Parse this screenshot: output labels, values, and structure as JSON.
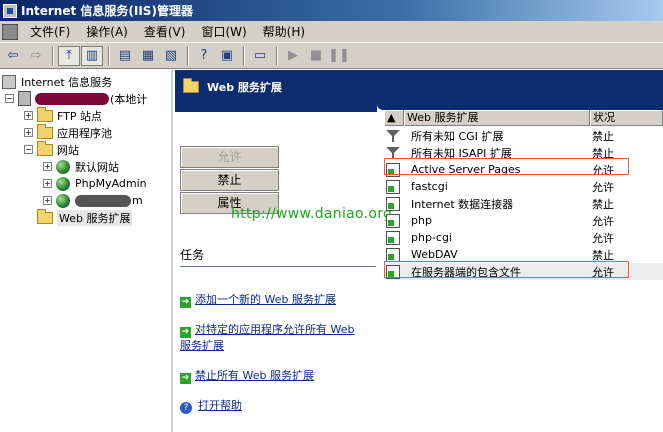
{
  "window": {
    "title": "Internet 信息服务(IIS)管理器"
  },
  "menu": [
    "文件(F)",
    "操作(A)",
    "查看(V)",
    "窗口(W)",
    "帮助(H)"
  ],
  "tree": {
    "root": "Internet 信息服务",
    "server_suffix": "(本地计",
    "items": {
      "ftp": "FTP 站点",
      "apppool": "应用程序池",
      "websites": "网站",
      "default_site": "默认网站",
      "phpmyadmin": "PhpMyAdmin",
      "third_site_suffix": "m",
      "web_ext": "Web 服务扩展"
    }
  },
  "pane": {
    "header": "Web 服务扩展",
    "buttons": {
      "allow": "允许",
      "deny": "禁止",
      "properties": "属性"
    },
    "tasks_title": "任务",
    "tasks": {
      "add_new": "添加一个新的 Web 服务扩展",
      "allow_all_line1": "对特定的应用程序允许所有 Web",
      "allow_all_line2": "服务扩展",
      "deny_all": "禁止所有 Web 服务扩展",
      "help": "打开帮助"
    },
    "watermark": "http://www.daniao.org"
  },
  "list": {
    "columns": {
      "name": "Web 服务扩展",
      "status": "状况"
    },
    "rows": [
      {
        "name": "所有未知 CGI 扩展",
        "status": "禁止",
        "icon": "filter-icon"
      },
      {
        "name": "所有未知 ISAPI 扩展",
        "status": "禁止",
        "icon": "filter-icon"
      },
      {
        "name": "Active Server Pages",
        "status": "允许",
        "icon": "extension-icon"
      },
      {
        "name": "fastcgi",
        "status": "允许",
        "icon": "extension-icon"
      },
      {
        "name": "Internet 数据连接器",
        "status": "禁止",
        "icon": "extension-icon"
      },
      {
        "name": "php",
        "status": "允许",
        "icon": "extension-icon"
      },
      {
        "name": "php-cgi",
        "status": "允许",
        "icon": "extension-icon"
      },
      {
        "name": "WebDAV",
        "status": "禁止",
        "icon": "extension-icon"
      },
      {
        "name": "在服务器端的包含文件",
        "status": "允许",
        "icon": "extension-icon"
      }
    ]
  }
}
